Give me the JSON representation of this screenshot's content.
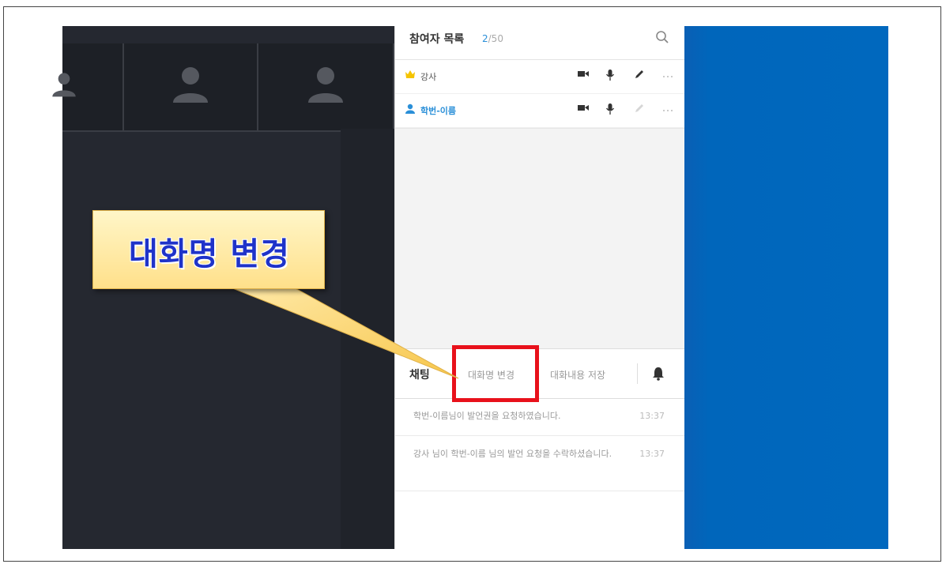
{
  "participants_panel": {
    "title": "참여자 목록",
    "count_current": "2",
    "count_max": "/50",
    "participants": [
      {
        "name": "강사",
        "role_icon": "crown-icon"
      },
      {
        "name": "학번-이름",
        "role_icon": "person-icon"
      }
    ]
  },
  "chat": {
    "title": "채팅",
    "rename_label": "대화명 변경",
    "save_label": "대화내용 저장",
    "messages": [
      {
        "text": "학번-이름님이 발언권을 요청하였습니다.",
        "time": "13:37"
      },
      {
        "text": "강사 님이 학번-이름 님의 발언 요청을 수락하셨습니다.",
        "time": "13:37"
      }
    ]
  },
  "callout": {
    "text": "대화명 변경"
  },
  "colors": {
    "accent_blue": "#2a8fd8",
    "highlight_red": "#e8111b",
    "callout_text": "#1f33c9",
    "right_panel_blue": "#0068be"
  }
}
